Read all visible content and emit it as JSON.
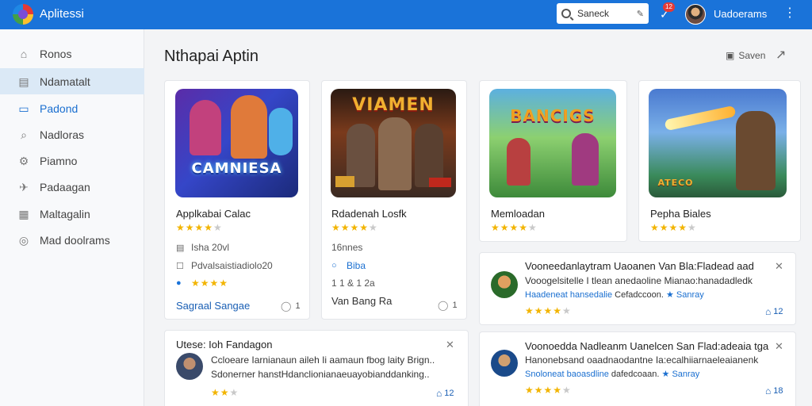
{
  "header": {
    "app_title": "Aplitessi",
    "search_placeholder": "Saneck",
    "notification_count": "12",
    "username": "Uadoerams",
    "colors": {
      "bar": "#1a73d9",
      "accent": "#1a6fd0"
    }
  },
  "sidebar": {
    "items": [
      {
        "label": "Ronos",
        "icon": "home-icon"
      },
      {
        "label": "Ndamatalt",
        "icon": "list-icon"
      },
      {
        "label": "Padond",
        "icon": "inbox-icon"
      },
      {
        "label": "Nadloras",
        "icon": "tag-icon"
      },
      {
        "label": "Piamno",
        "icon": "piano-icon"
      },
      {
        "label": "Padaagan",
        "icon": "pin-icon"
      },
      {
        "label": "Maltagalin",
        "icon": "document-icon"
      },
      {
        "label": "Mad doolrams",
        "icon": "settings-icon"
      }
    ]
  },
  "main": {
    "title": "Nthapai Aptin",
    "save_label": "Saven",
    "share_icon": "share-icon"
  },
  "cards": [
    {
      "art_text": "CAMNIESA",
      "title": "Applkabai Calac",
      "rating": 4,
      "meta1": "Isha 20vl",
      "meta2": "Pdvalsaistiadiolo20",
      "meta3_rating": 4,
      "link": "Sagraal Sangae",
      "count": "1"
    },
    {
      "art_text": "VIAMEN",
      "title": "Rdadenah Losfk",
      "rating": 4,
      "meta1": "16nnes",
      "meta2": "Biba",
      "meta3": "1 1 & 1 2a",
      "link": "Van Bang Ra",
      "count": "1"
    },
    {
      "art_text": "BANCIGS",
      "title": "Memloadan",
      "rating": 4
    },
    {
      "art_text": "ATECO",
      "title": "Pepha Biales",
      "rating": 4
    }
  ],
  "reviews": [
    {
      "title": "Vooneedanlaytram Uaoanen Van Bla:Fladead aad",
      "body": "Vooogelsitelle I tlean anedaoline Mianao:hanadadledk",
      "tag1": "Haadeneat hansedalie",
      "tag2": "Cefadccoon.",
      "tag3": "Sanray",
      "rating": 4,
      "count": "12"
    },
    {
      "title": "Utese: Ioh Fandagon",
      "body": "Ccloeare Iarnianaun aileh Ii aamaun fbog laity Brign..",
      "body2": "Sdonerner hanstHdanclionianaeuayobianddanking..",
      "rating": 2,
      "count": "12"
    },
    {
      "title": "Voonoedda Nadleanm Uanelcen San Flad:adeaia tga",
      "body": "Hanonebsand oaadnaodantne Ia:ecalhiiarnaeleaianenk",
      "tag1": "Snoloneat baoasdline",
      "tag2": "dafedcoaan.",
      "tag3": "Sanray",
      "rating": 4,
      "count": "18"
    }
  ]
}
